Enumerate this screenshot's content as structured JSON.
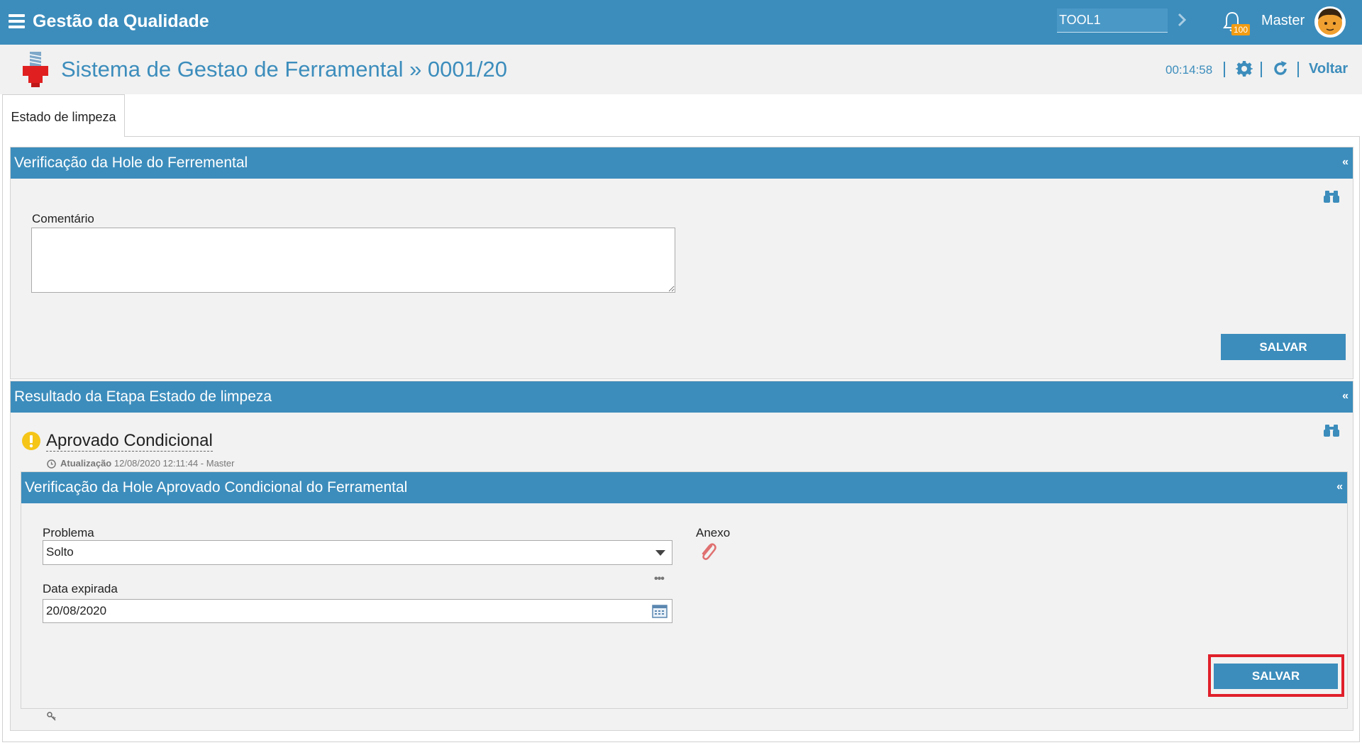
{
  "header": {
    "app_title": "Gestão da Qualidade",
    "tool_value": "TOOL1",
    "notification_count": "100",
    "user_name": "Master"
  },
  "page": {
    "title": "Sistema de Gestao de Ferramental » 0001/20",
    "timer": "00:14:58",
    "back_label": "Voltar"
  },
  "tabs": [
    {
      "label": "Estado de limpeza",
      "active": true
    }
  ],
  "panel_verificacao": {
    "title": "Verificação da Hole do Ferremental",
    "collapse": "«",
    "comment_label": "Comentário",
    "comment_value": "",
    "save_label": "SALVAR"
  },
  "panel_resultado": {
    "title": "Resultado da Etapa Estado de limpeza",
    "collapse": "«",
    "status": "Aprovado Condicional",
    "update_label": "Atualização",
    "update_info": "12/08/2020 12:11:44 - Master"
  },
  "panel_condicional": {
    "title": "Verificação da Hole Aprovado Condicional do Ferramental",
    "collapse": "«",
    "problem_label": "Problema",
    "problem_value": "Solto",
    "expiry_label": "Data expirada",
    "expiry_value": "20/08/2020",
    "attachment_label": "Anexo",
    "more_label": "•••",
    "save_label": "SALVAR"
  },
  "colors": {
    "primary": "#3c8dbc",
    "warning": "#f5c518",
    "badge": "#f39c12",
    "highlight": "#e0202b"
  }
}
